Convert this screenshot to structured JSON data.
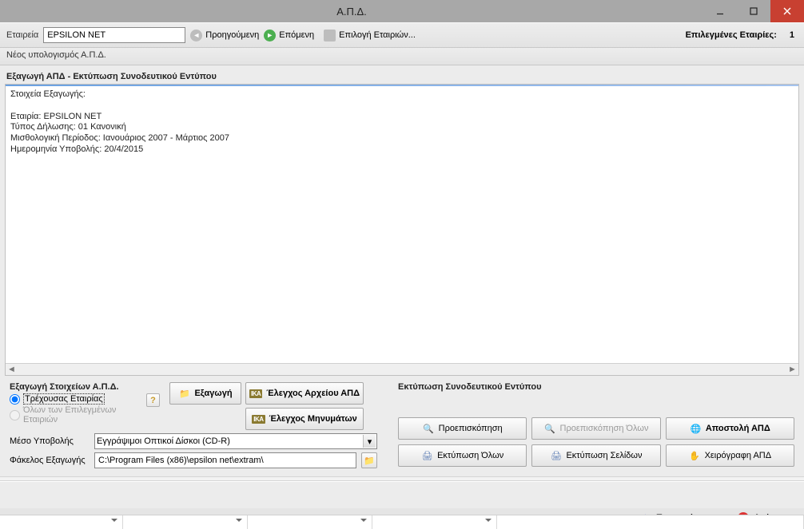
{
  "window": {
    "title": "Α.Π.Δ."
  },
  "toolbar": {
    "company_label": "Εταιρεία",
    "company_value": "EPSILON NET",
    "prev": "Προηγούμενη",
    "next": "Επόμενη",
    "select_companies": "Επιλογή Εταιριών...",
    "selected_label": "Επιλεγμένες Εταιρίες:",
    "selected_count": "1"
  },
  "breadcrumb": "Νέος υπολογισμός Α.Π.Δ.",
  "section_title": "Εξαγωγή ΑΠΔ - Εκτύπωση Συνοδευτικού Εντύπου",
  "details": {
    "header": "Στοιχεία Εξαγωγής:",
    "line1": "Εταιρία: EPSILON NET",
    "line2": "Τύπος Δήλωσης: 01 Κανονική",
    "line3": "Μισθολογική Περίοδος: Ιανουάριος 2007 - Μάρτιος 2007",
    "line4": "Ημερομηνία Υποβολής: 20/4/2015"
  },
  "export_panel": {
    "title": "Εξαγωγή Στοιχείων Α.Π.Δ.",
    "radio_current": "Τρέχουσας Εταιρίας",
    "radio_all": "Όλων των Επιλεγμένων Εταιριών",
    "help": "?",
    "export_btn": "Εξαγωγή",
    "check_file_btn": "Έλεγχος Αρχείου ΑΠΔ",
    "check_msg_btn": "Έλεγχος Μηνυμάτων",
    "medium_label": "Μέσο Υποβολής",
    "medium_value": "Εγγράψιμοι Οπτικοί Δίσκοι (CD-R)",
    "folder_label": "Φάκελος Εξαγωγής",
    "folder_value": "C:\\Program Files (x86)\\epsilon net\\extram\\"
  },
  "print_panel": {
    "title": "Εκτύπωση Συνοδευτικού Εντύπου",
    "preview": "Προεπισκόπηση",
    "preview_all": "Προεπισκόπηση Όλων",
    "send": "Αποστολή ΑΠΔ",
    "print_all": "Εκτύπωση Όλων",
    "print_pages": "Εκτύπωση Σελίδων",
    "handwritten": "Χειρόγραφη ΑΠΔ"
  },
  "footer": {
    "prev": "Προηγούμενη",
    "cancel": "Ακύρωση"
  }
}
